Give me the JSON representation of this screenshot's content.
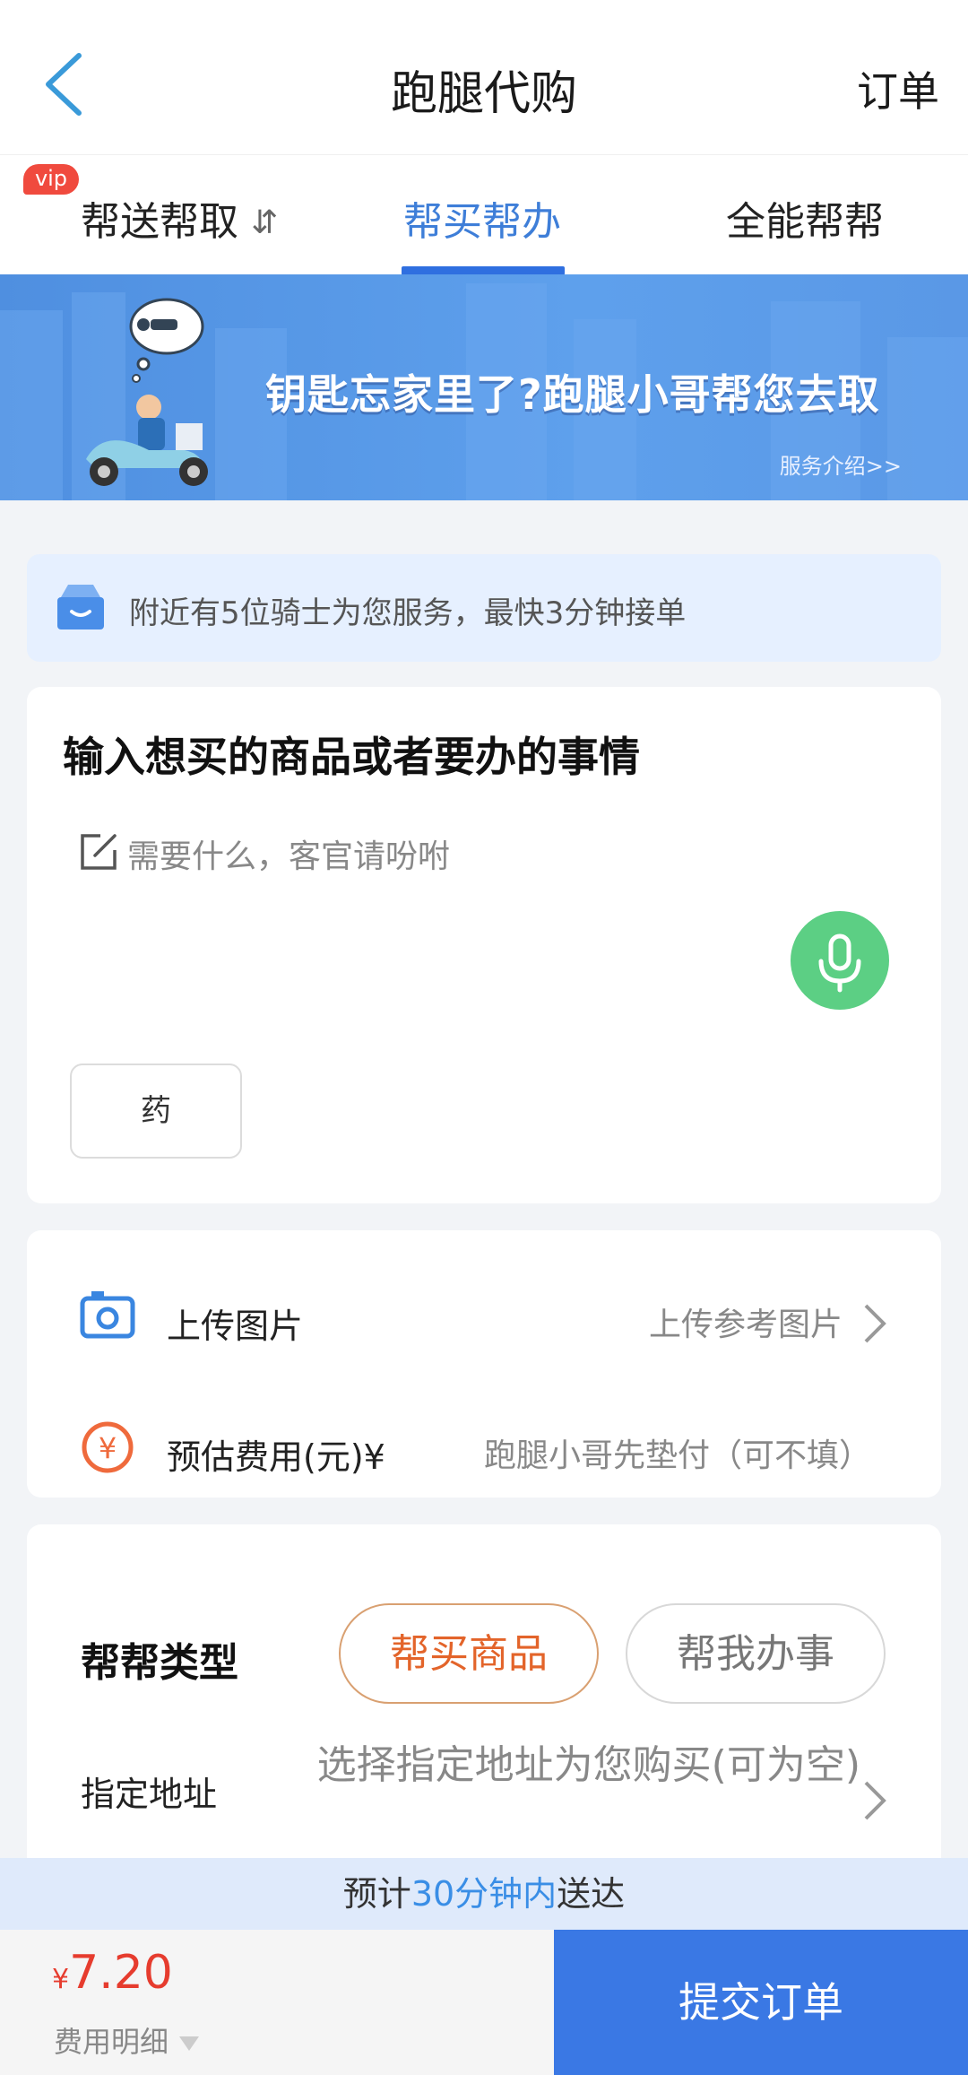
{
  "header": {
    "title": "跑腿代购",
    "orders_label": "订单"
  },
  "tabs": {
    "items": [
      {
        "label": "帮送帮取",
        "badge": "vip"
      },
      {
        "label": "帮买帮办"
      },
      {
        "label": "全能帮帮"
      }
    ],
    "swap_glyph": "⇵",
    "active_color": "#3e7ed8"
  },
  "banner": {
    "headline": "钥匙忘家里了?跑腿小哥帮您去取",
    "link": "服务介绍>>"
  },
  "notice": {
    "text": "附近有5位骑士为您服务，最快3分钟接单"
  },
  "request": {
    "title": "输入想买的商品或者要办的事情",
    "placeholder": "需要什么，客官请吩咐",
    "chip": "药"
  },
  "options": {
    "upload_label": "上传图片",
    "upload_value": "上传参考图片",
    "fee_label": "预估费用(元)¥",
    "fee_placeholder": "跑腿小哥先垫付（可不填）"
  },
  "help_type": {
    "label": "帮帮类型",
    "choices": [
      "帮买商品",
      "帮我办事"
    ],
    "selected": "帮买商品",
    "address_label": "指定地址",
    "address_value": "选择指定地址为您购买(可为空)"
  },
  "eta": {
    "prefix": "预计",
    "highlight": "30分钟内",
    "suffix": "送达"
  },
  "footer": {
    "currency": "¥",
    "price": "7.20",
    "fee_detail": "费用明细",
    "submit": "提交订单"
  },
  "colors": {
    "accent_blue": "#3a78e4",
    "price_red": "#e63c2e",
    "mic_green": "#5ccf84",
    "pill_orange": "#e3642a"
  }
}
